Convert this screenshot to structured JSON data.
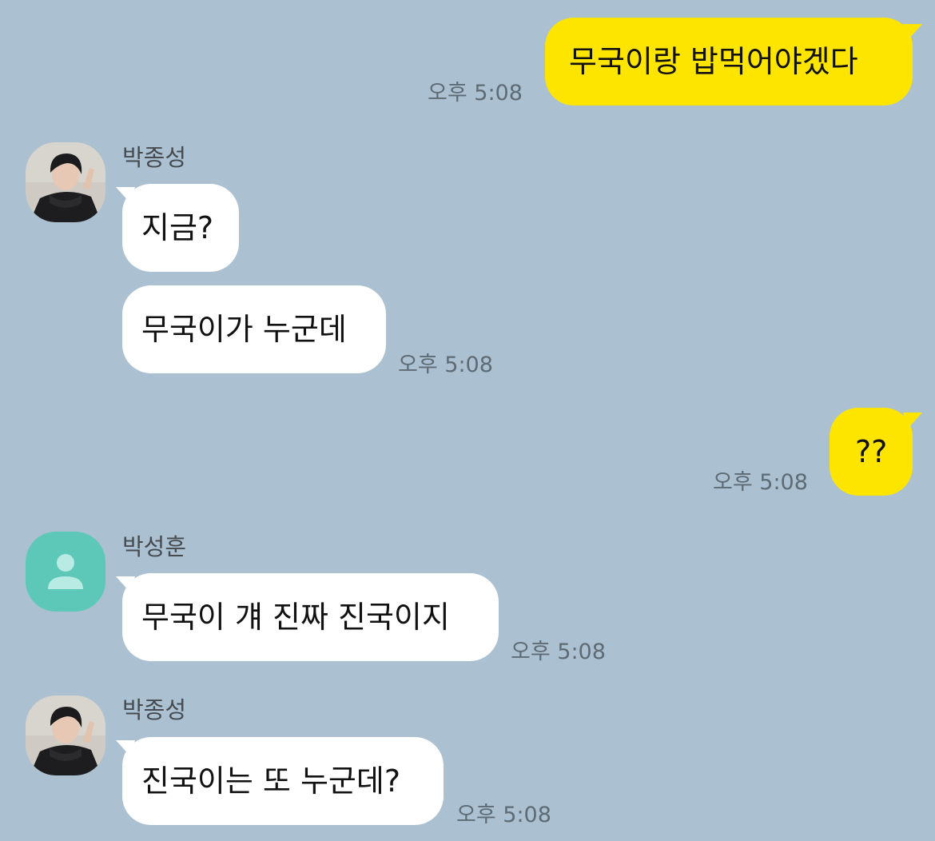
{
  "messages": [
    {
      "id": "m1",
      "text": "무국이랑 밥먹어야겠다",
      "time": "오후 5:08"
    },
    {
      "id": "m2_sender",
      "sender": "박종성"
    },
    {
      "id": "m2",
      "text": "지금?"
    },
    {
      "id": "m3",
      "text": "무국이가 누군데",
      "time": "오후 5:08"
    },
    {
      "id": "m4",
      "text": "??",
      "time": "오후 5:08"
    },
    {
      "id": "m5_sender",
      "sender": "박성훈"
    },
    {
      "id": "m5",
      "text": "무국이 걔 진짜 진국이지",
      "time": "오후 5:08"
    },
    {
      "id": "m6_sender",
      "sender": "박종성"
    },
    {
      "id": "m6",
      "text": "진국이는 또 누군데?",
      "time": "오후 5:08"
    }
  ],
  "colors": {
    "background": "#abc1d1",
    "mine_bubble": "#fee500",
    "their_bubble": "#ffffff",
    "default_avatar": "#5ec8b8"
  },
  "icons": {
    "photo_avatar": "profile-photo",
    "default_avatar": "person-icon"
  }
}
